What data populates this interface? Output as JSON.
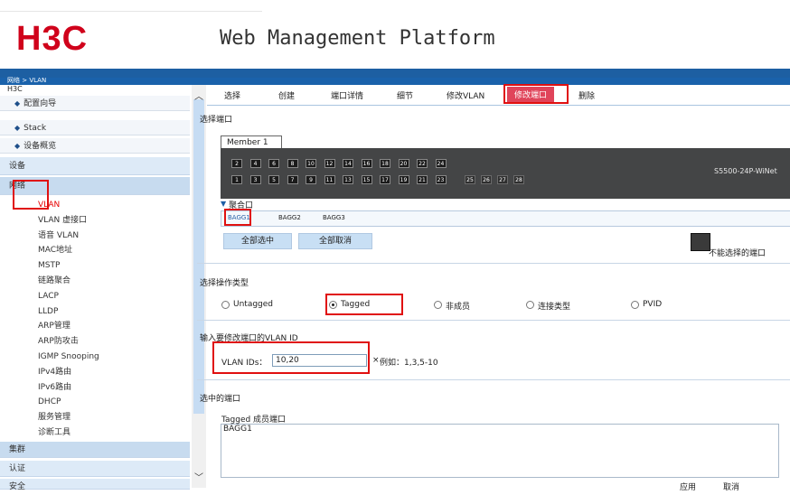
{
  "header": {
    "logo": "H3C",
    "title": "Web Management Platform",
    "breadcrumb": "网络 > VLAN"
  },
  "sidebar": {
    "root": "H3C",
    "top_items": [
      "配置向导",
      "Stack",
      "设备概览"
    ],
    "sections": [
      "设备",
      "网络"
    ],
    "network_items": [
      "VLAN",
      "VLAN 虚接口",
      "语音 VLAN",
      "MAC地址",
      "MSTP",
      "链路聚合",
      "LACP",
      "LLDP",
      "ARP管理",
      "ARP防攻击",
      "IGMP Snooping",
      "IPv4路由",
      "IPv6路由",
      "DHCP",
      "服务管理",
      "诊断工具"
    ],
    "bottom_sections": [
      "集群",
      "认证",
      "安全"
    ],
    "active_item": "VLAN"
  },
  "tabs": [
    "选择",
    "创建",
    "端口详情",
    "细节",
    "修改VLAN",
    "修改端口",
    "删除"
  ],
  "active_tab": "修改端口",
  "select_ports": {
    "title": "选择端口",
    "member_tab": "Member 1",
    "ports_top": [
      "2",
      "4",
      "6",
      "8",
      "10",
      "12",
      "14",
      "16",
      "18",
      "20",
      "22",
      "24"
    ],
    "ports_bottom": [
      "1",
      "3",
      "5",
      "7",
      "9",
      "11",
      "13",
      "15",
      "17",
      "19",
      "21",
      "23"
    ],
    "ports_extra": [
      "25",
      "26",
      "27",
      "28"
    ],
    "switch_model": "S5500-24P-WiNet",
    "agg_caption": "聚合口",
    "agg_ports": [
      "BAGG1",
      "BAGG2",
      "BAGG3"
    ],
    "select_all": "全部选中",
    "deselect_all": "全部取消",
    "legend": "不能选择的端口"
  },
  "operation": {
    "title": "选择操作类型",
    "options": [
      "Untagged",
      "Tagged",
      "非成员",
      "连接类型",
      "PVID"
    ],
    "selected": "Tagged"
  },
  "vlan_input": {
    "title": "输入要修改端口的VLAN ID",
    "label": "VLAN IDs：",
    "value": "10,20",
    "clear": "×",
    "example": "例如：1,3,5-10"
  },
  "selected_ports": {
    "title": "选中的端口",
    "caption": "Tagged 成员端口",
    "content": "BAGG1"
  },
  "footer_buttons": [
    "应用",
    "取消"
  ]
}
